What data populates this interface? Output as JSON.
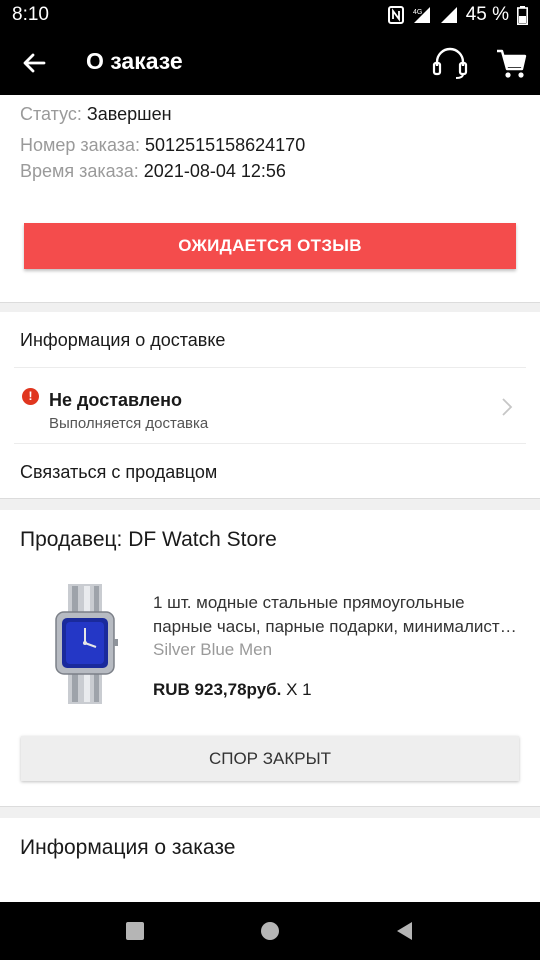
{
  "status_bar": {
    "time": "8:10",
    "battery": "45 %",
    "network": "4G"
  },
  "app_bar": {
    "title": "О заказе",
    "back_icon": "arrow-left-icon",
    "support_icon": "headset-icon",
    "cart_icon": "cart-icon"
  },
  "order": {
    "status_label": "Статус:",
    "status_value": "Завершен",
    "number_label": "Номер заказа:",
    "number_value": "5012515158624170",
    "time_label": "Время заказа:",
    "time_value": "2021-08-04 12:56",
    "review_button": "ОЖИДАЕТСЯ ОТЗЫВ"
  },
  "delivery": {
    "heading": "Информация о доставке",
    "status_title": "Не доставлено",
    "status_sub": "Выполняется доставка",
    "contact_seller": "Связаться с продавцом"
  },
  "seller": {
    "label": "Продавец: DF Watch Store",
    "product": {
      "title_line1": "1 шт. модные стальные прямоугольные",
      "title_line2": "парные часы, парные подарки, минималистичные",
      "variant": "Silver Blue Men",
      "price": "RUB 923,78руб.",
      "quantity": "X 1"
    },
    "dispute_button": "СПОР ЗАКРЫТ"
  },
  "order_info": {
    "heading": "Информация о заказе"
  },
  "colors": {
    "accent": "#f44c4c",
    "alert": "#e0361f",
    "header_bg": "#000000"
  }
}
